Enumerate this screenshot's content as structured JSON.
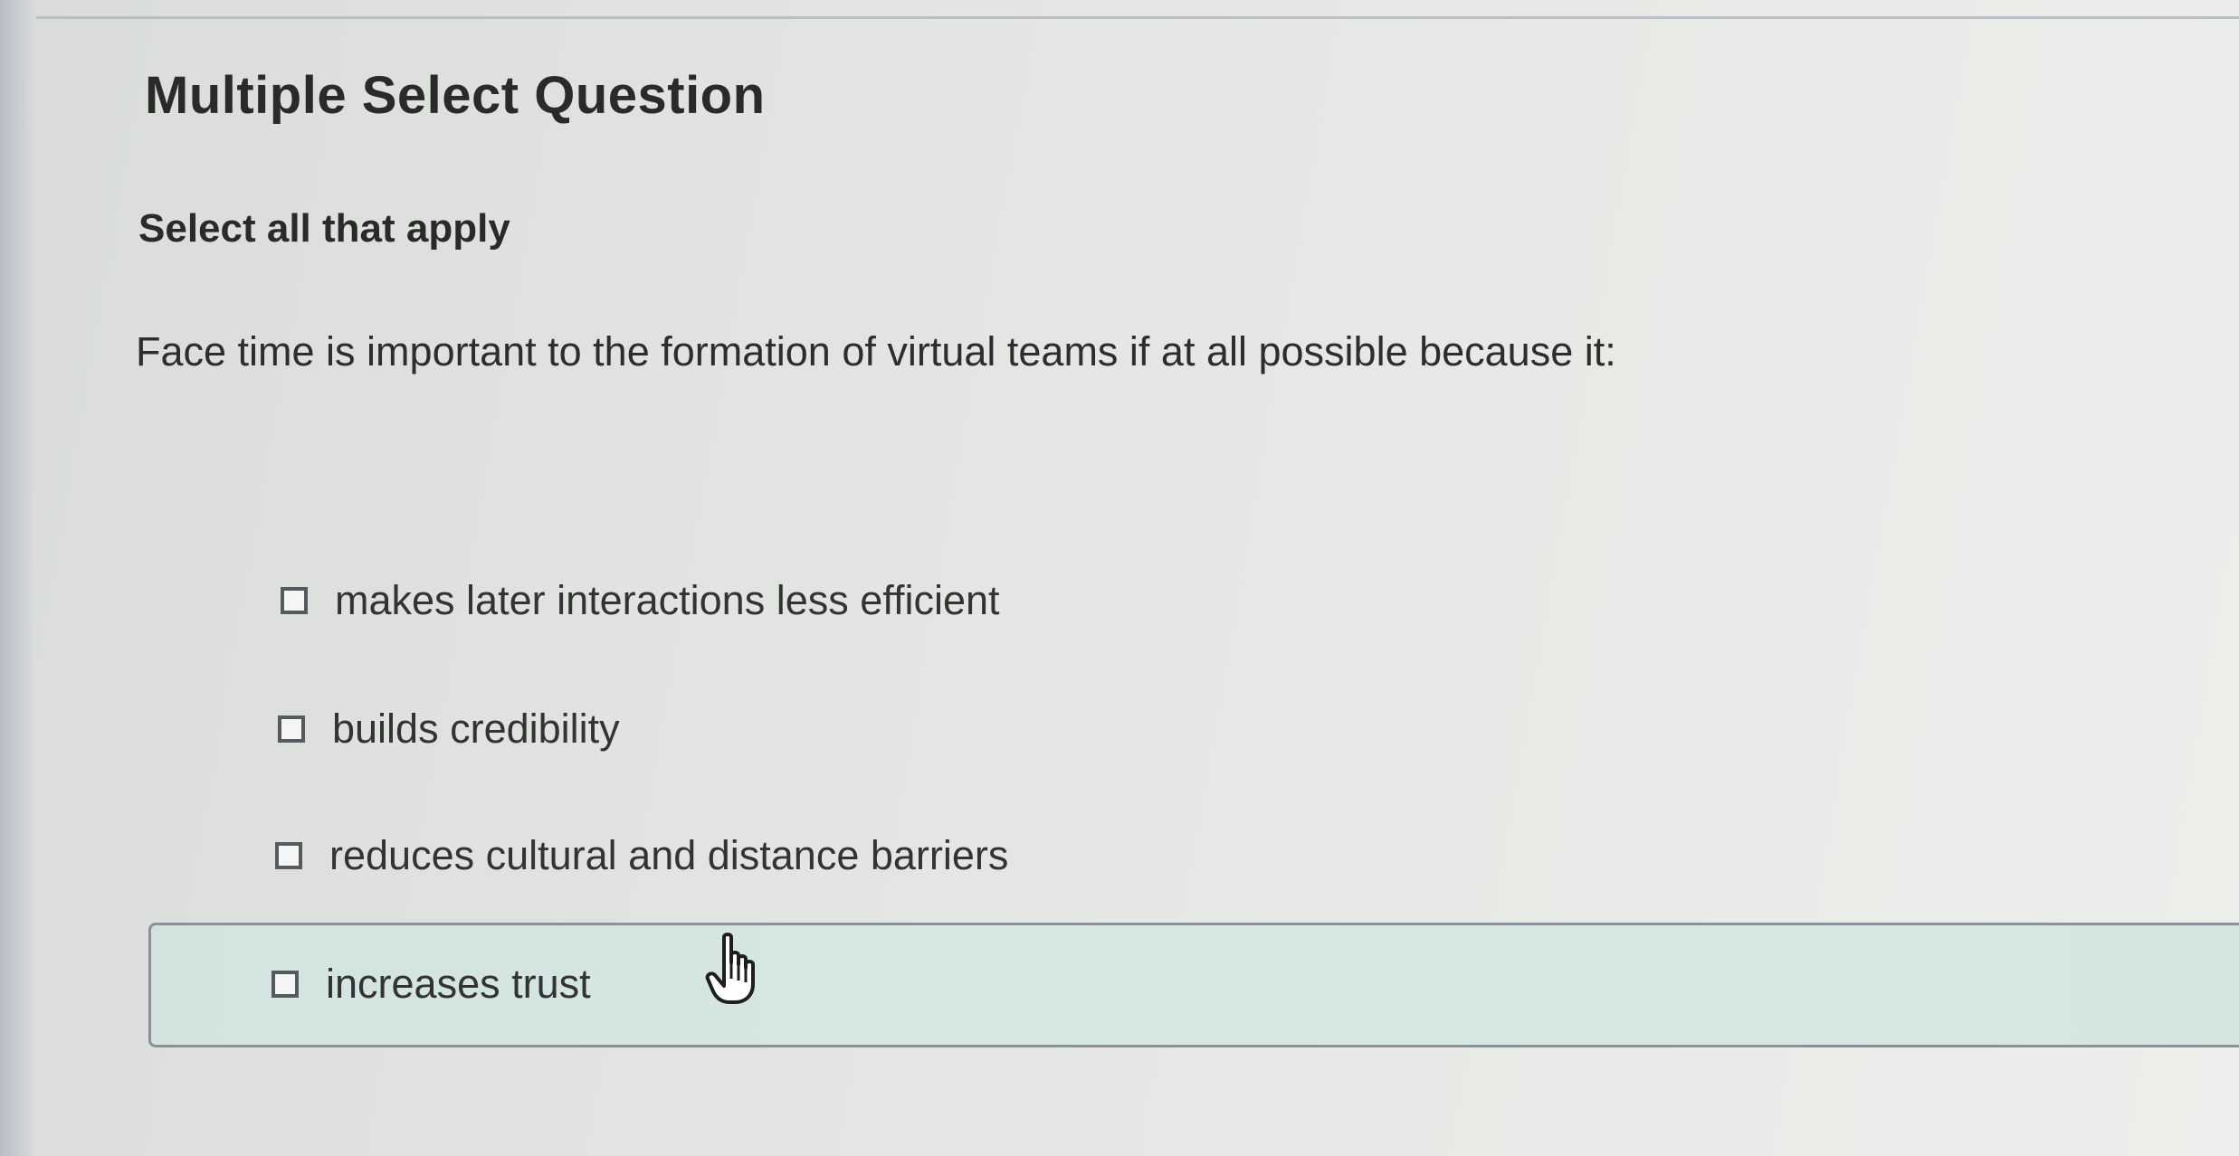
{
  "question": {
    "type_label": "Multiple Select Question",
    "instruction": "Select all that apply",
    "prompt": "Face time is important to the formation of virtual teams if at all possible because it:"
  },
  "options": [
    {
      "label": "makes later interactions less efficient",
      "checked": false
    },
    {
      "label": "builds credibility",
      "checked": false
    },
    {
      "label": "reduces cultural and distance barriers",
      "checked": false
    },
    {
      "label": "increases trust",
      "checked": false,
      "hovered": true
    }
  ],
  "icons": {
    "checkbox": "checkbox-icon",
    "cursor": "hand-pointer-icon"
  },
  "colors": {
    "hover_row_background": "#d5e6e2",
    "checkbox_border": "#555a5f",
    "text": "#2d2d2d"
  }
}
